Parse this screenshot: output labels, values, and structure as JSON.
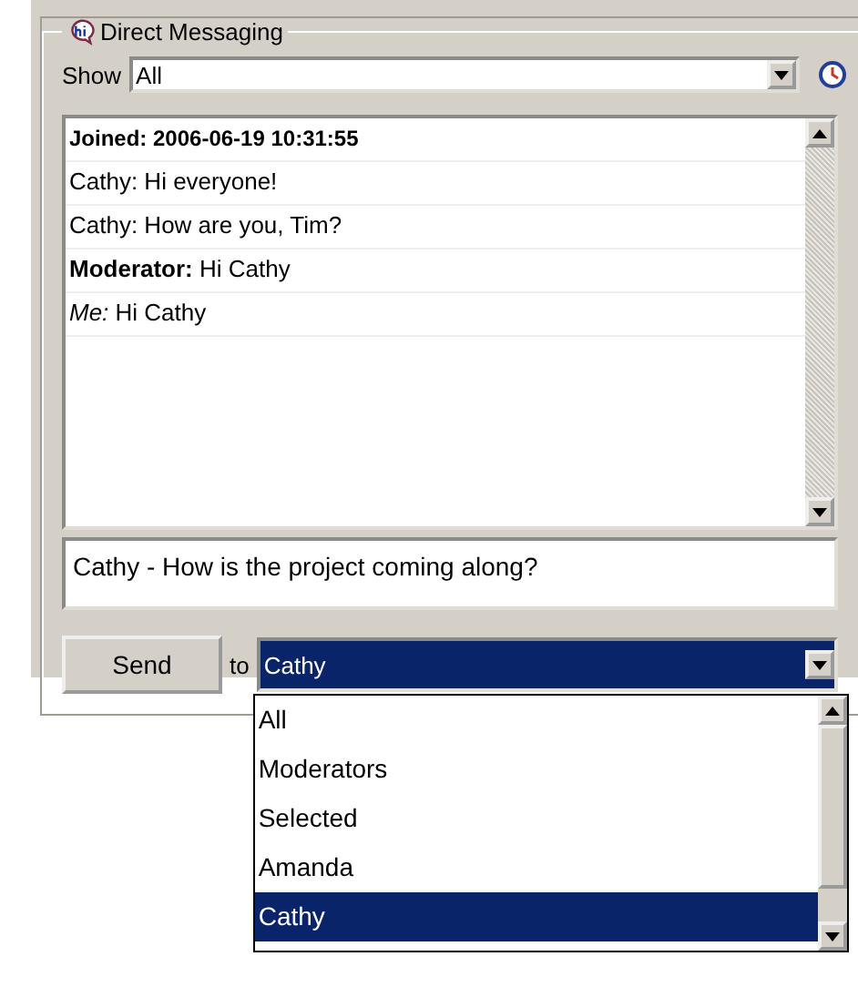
{
  "group": {
    "title": "Direct Messaging"
  },
  "show": {
    "label": "Show",
    "value": "All"
  },
  "messages": [
    {
      "kind": "system",
      "text": "Joined: 2006-06-19 10:31:55"
    },
    {
      "kind": "message",
      "text": "Cathy: Hi everyone!"
    },
    {
      "kind": "message",
      "text": "Cathy: How are you, Tim?"
    },
    {
      "kind": "message",
      "text": "**Moderator:** Hi Cathy"
    },
    {
      "kind": "message",
      "text": "*Me:* Hi Cathy"
    }
  ],
  "compose": {
    "value": "Cathy - How is the project coming along?"
  },
  "send_button": "Send",
  "to_label": "to",
  "recipient": {
    "value": "Cathy",
    "expanded": true,
    "options": [
      {
        "label": "All",
        "selected": false
      },
      {
        "label": "Moderators",
        "selected": false
      },
      {
        "label": "Selected",
        "selected": false
      },
      {
        "label": "Amanda",
        "selected": false
      },
      {
        "label": "Cathy",
        "selected": true
      }
    ]
  }
}
